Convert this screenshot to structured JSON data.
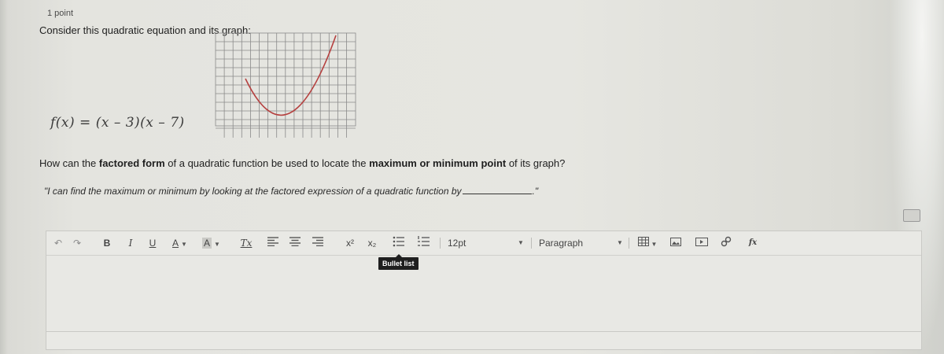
{
  "question": {
    "points": "1 point",
    "prompt": "Consider this quadratic equation and its graph:",
    "equation": "f(x) = (x – 3)(x – 7)",
    "text_before_bold1": "How can the ",
    "bold1": "factored form",
    "text_mid": " of a quadratic function be used to locate the ",
    "bold2": "maximum or minimum point",
    "text_after": " of its graph?",
    "answer_prefix": "\"I can find the maximum or minimum by looking at the factored expression of a quadratic function by",
    "answer_suffix": ".\""
  },
  "graph": {
    "curve_color": "#b5403f",
    "grid_color": "#8a8a8a"
  },
  "toolbar": {
    "undo_icon": "undo-icon",
    "redo_icon": "redo-icon",
    "bold": "B",
    "italic": "I",
    "underline": "U",
    "text_color": "A",
    "highlight": "A",
    "clear_format": "Tx",
    "superscript": "x²",
    "subscript": "x₂",
    "font_size": "12pt",
    "block_format": "Paragraph",
    "tooltip": "Bullet list"
  }
}
